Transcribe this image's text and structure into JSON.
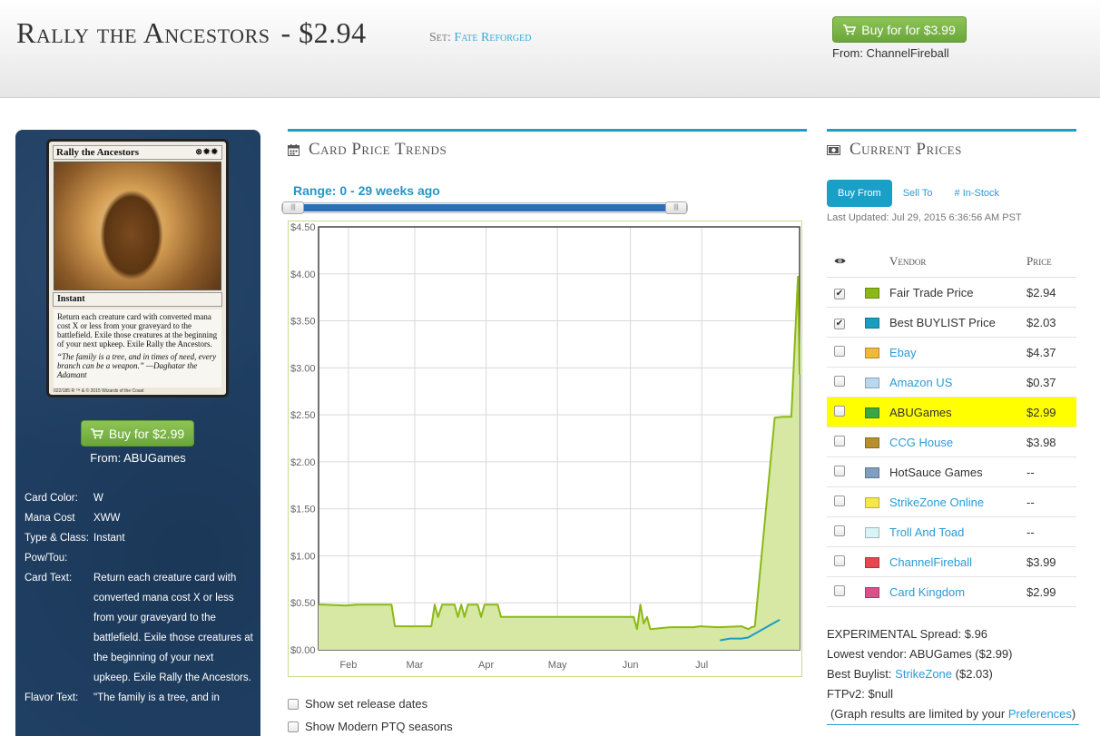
{
  "header": {
    "card_name": "Rally the Ancestors",
    "title_price": "- $2.94",
    "set_prefix": "Set:",
    "set_name": "Fate Reforged",
    "buy_button_label": "Buy for for $3.99",
    "buy_from": "From: ChannelFireball"
  },
  "card_image": {
    "name": "Rally the Ancestors",
    "mana_symbols": "⊗✹✹",
    "type_line": "Instant",
    "rules_text": "Return each creature card with converted mana cost X or less from your graveyard to the battlefield. Exile those creatures at the beginning of your next upkeep. Exile Rally the Ancestors.",
    "flavor_text": "“The family is a tree, and in times of need, every branch can be a weapon.” —Daghatar the Adamant",
    "footer": "022/185 R ™ & © 2015 Wizards of the Coast"
  },
  "left": {
    "buy_button_label": "Buy for $2.99",
    "buy_from": "From: ABUGames",
    "details": [
      {
        "label": "Card Color:",
        "value": "W"
      },
      {
        "label": "Mana Cost",
        "value": "XWW"
      },
      {
        "label": "Type & Class:",
        "value": "Instant"
      },
      {
        "label": "Pow/Tou:",
        "value": ""
      },
      {
        "label": "Card Text:",
        "value": "Return each creature card with converted mana cost X or less from your graveyard to the battlefield. Exile those creatures at the beginning of your next upkeep. Exile Rally the Ancestors."
      },
      {
        "label": "Flavor Text:",
        "value": "\"The family is a tree, and in"
      }
    ]
  },
  "trends": {
    "title": "Card Price Trends",
    "range_label": "Range: 0 - 29 weeks ago",
    "slider": {
      "start_fraction": 0.0,
      "end_fraction": 1.0
    },
    "checkboxes": [
      {
        "label": "Show set release dates",
        "checked": false
      },
      {
        "label": "Show Modern PTQ seasons",
        "checked": false
      }
    ]
  },
  "chart_data": {
    "type": "area",
    "ylim": [
      0,
      4.5
    ],
    "y_ticks": [
      0,
      0.5,
      1.0,
      1.5,
      2.0,
      2.5,
      3.0,
      3.5,
      4.0,
      4.5
    ],
    "y_tick_labels": [
      "$0.00",
      "$0.50",
      "$1.00",
      "$1.50",
      "$2.00",
      "$2.50",
      "$3.00",
      "$3.50",
      "$4.00",
      "$4.50"
    ],
    "x_range_weeks": [
      0,
      29
    ],
    "x_tick_labels": [
      {
        "label": "Feb",
        "week": 1.8
      },
      {
        "label": "Mar",
        "week": 5.8
      },
      {
        "label": "Apr",
        "week": 10.1
      },
      {
        "label": "May",
        "week": 14.4
      },
      {
        "label": "Jun",
        "week": 18.8
      },
      {
        "label": "Jul",
        "week": 23.1
      }
    ],
    "grid": true,
    "series": [
      {
        "name": "Fair Trade Price",
        "color": "#8cb817",
        "fill": "#d6e8a4",
        "points": [
          [
            0.0,
            0.48
          ],
          [
            0.3,
            0.48
          ],
          [
            1.6,
            0.47
          ],
          [
            2.3,
            0.48
          ],
          [
            4.4,
            0.48
          ],
          [
            4.6,
            0.25
          ],
          [
            6.8,
            0.25
          ],
          [
            7.0,
            0.48
          ],
          [
            7.2,
            0.35
          ],
          [
            7.45,
            0.48
          ],
          [
            8.2,
            0.48
          ],
          [
            8.4,
            0.35
          ],
          [
            8.6,
            0.48
          ],
          [
            8.8,
            0.35
          ],
          [
            9.0,
            0.48
          ],
          [
            9.6,
            0.48
          ],
          [
            9.8,
            0.35
          ],
          [
            10.0,
            0.48
          ],
          [
            10.8,
            0.48
          ],
          [
            11.0,
            0.35
          ],
          [
            19.0,
            0.35
          ],
          [
            19.2,
            0.22
          ],
          [
            19.4,
            0.48
          ],
          [
            19.6,
            0.28
          ],
          [
            19.8,
            0.35
          ],
          [
            20.0,
            0.22
          ],
          [
            21.2,
            0.24
          ],
          [
            22.6,
            0.24
          ],
          [
            23.0,
            0.25
          ],
          [
            24.1,
            0.24
          ],
          [
            25.5,
            0.25
          ],
          [
            25.9,
            0.22
          ],
          [
            26.1,
            0.24
          ],
          [
            26.3,
            0.25
          ],
          [
            27.5,
            2.47
          ],
          [
            28.0,
            2.48
          ],
          [
            28.5,
            2.48
          ],
          [
            28.9,
            3.97
          ],
          [
            29.0,
            2.93
          ]
        ]
      },
      {
        "name": "Best BUYLIST Price",
        "color": "#1b9dc1",
        "fill": "none",
        "points": [
          [
            24.2,
            0.1
          ],
          [
            24.8,
            0.12
          ],
          [
            25.5,
            0.12
          ],
          [
            25.9,
            0.13
          ],
          [
            26.6,
            0.2
          ],
          [
            27.3,
            0.27
          ],
          [
            27.8,
            0.32
          ]
        ]
      }
    ]
  },
  "current_prices": {
    "title": "Current Prices",
    "tabs": [
      {
        "label": "Buy From",
        "active": true
      },
      {
        "label": "Sell To",
        "active": false
      },
      {
        "label": "# In-Stock",
        "active": false
      }
    ],
    "last_updated": "Last Updated: Jul 29, 2015 6:36:56 AM PST",
    "columns": {
      "vendor": "Vendor",
      "price": "Price"
    },
    "vendors": [
      {
        "name": "Fair Trade Price",
        "price": "$2.94",
        "color": "#8cb817",
        "checked": true,
        "link": false,
        "highlight": false
      },
      {
        "name": "Best BUYLIST Price",
        "price": "$2.03",
        "color": "#1b9dc1",
        "checked": true,
        "link": false,
        "highlight": false
      },
      {
        "name": "Ebay",
        "price": "$4.37",
        "color": "#f0b93a",
        "checked": false,
        "link": true,
        "highlight": false
      },
      {
        "name": "Amazon US",
        "price": "$0.37",
        "color": "#b8d8f0",
        "checked": false,
        "link": true,
        "highlight": false
      },
      {
        "name": "ABUGames",
        "price": "$2.99",
        "color": "#3da644",
        "checked": false,
        "link": false,
        "highlight": true
      },
      {
        "name": "CCG House",
        "price": "$3.98",
        "color": "#b88f2e",
        "checked": false,
        "link": true,
        "highlight": false
      },
      {
        "name": "HotSauce Games",
        "price": "--",
        "color": "#7f9fc0",
        "checked": false,
        "link": false,
        "highlight": false
      },
      {
        "name": "StrikeZone Online",
        "price": "--",
        "color": "#f7e84a",
        "checked": false,
        "link": true,
        "highlight": false
      },
      {
        "name": "Troll And Toad",
        "price": "--",
        "color": "#d8f4f8",
        "checked": false,
        "link": true,
        "highlight": false
      },
      {
        "name": "ChannelFireball",
        "price": "$3.99",
        "color": "#e8474f",
        "checked": false,
        "link": true,
        "highlight": false
      },
      {
        "name": "Card Kingdom",
        "price": "$2.99",
        "color": "#d8508c",
        "checked": false,
        "link": true,
        "highlight": false
      }
    ],
    "summary": {
      "spread": "EXPERIMENTAL Spread: $.96",
      "lowest_vendor": "Lowest vendor: ABUGames ($2.99)",
      "best_buylist_prefix": "Best Buylist:",
      "best_buylist_vendor": "StrikeZone",
      "best_buylist_price": "($2.03)",
      "ftpv2": "FTPv2: $null",
      "pref_note_prefix": "(Graph results are limited by your",
      "pref_link": "Preferences",
      "pref_note_suffix": ")"
    }
  }
}
